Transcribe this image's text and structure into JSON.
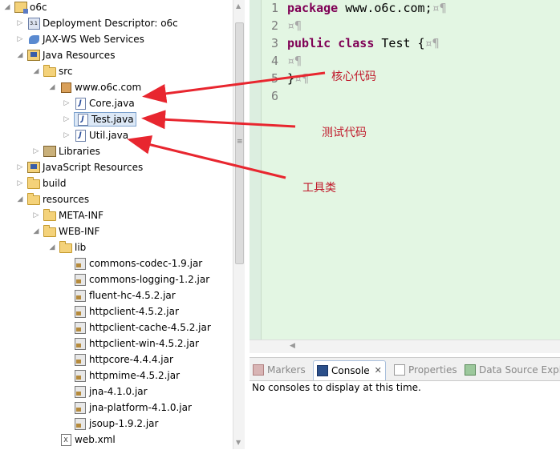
{
  "explorer": {
    "items": [
      {
        "label": "o6c",
        "icon": "project-icon"
      },
      {
        "label": "Deployment Descriptor: o6c",
        "icon": "deployment-descriptor-icon"
      },
      {
        "label": "JAX-WS Web Services",
        "icon": "web-services-icon"
      },
      {
        "label": "Java Resources",
        "icon": "java-resources-icon"
      },
      {
        "label": "src",
        "icon": "source-folder-icon"
      },
      {
        "label": "www.o6c.com",
        "icon": "package-icon"
      },
      {
        "label": "Core.java",
        "icon": "java-file-icon"
      },
      {
        "label": "Test.java",
        "icon": "java-file-icon"
      },
      {
        "label": "Util.java",
        "icon": "java-file-icon"
      },
      {
        "label": "Libraries",
        "icon": "libraries-icon"
      },
      {
        "label": "JavaScript Resources",
        "icon": "javascript-resources-icon"
      },
      {
        "label": "build",
        "icon": "folder-icon"
      },
      {
        "label": "resources",
        "icon": "folder-icon"
      },
      {
        "label": "META-INF",
        "icon": "folder-icon"
      },
      {
        "label": "WEB-INF",
        "icon": "folder-icon"
      },
      {
        "label": "lib",
        "icon": "folder-icon"
      },
      {
        "label": "commons-codec-1.9.jar",
        "icon": "jar-icon"
      },
      {
        "label": "commons-logging-1.2.jar",
        "icon": "jar-icon"
      },
      {
        "label": "fluent-hc-4.5.2.jar",
        "icon": "jar-icon"
      },
      {
        "label": "httpclient-4.5.2.jar",
        "icon": "jar-icon"
      },
      {
        "label": "httpclient-cache-4.5.2.jar",
        "icon": "jar-icon"
      },
      {
        "label": "httpclient-win-4.5.2.jar",
        "icon": "jar-icon"
      },
      {
        "label": "httpcore-4.4.4.jar",
        "icon": "jar-icon"
      },
      {
        "label": "httpmime-4.5.2.jar",
        "icon": "jar-icon"
      },
      {
        "label": "jna-4.1.0.jar",
        "icon": "jar-icon"
      },
      {
        "label": "jna-platform-4.1.0.jar",
        "icon": "jar-icon"
      },
      {
        "label": "jsoup-1.9.2.jar",
        "icon": "jar-icon"
      },
      {
        "label": "web.xml",
        "icon": "xml-file-icon"
      }
    ]
  },
  "editor": {
    "lines": [
      {
        "num": "1",
        "kw": "package",
        "rest": " www.o6c.com;",
        "mark": "¤¶"
      },
      {
        "num": "2",
        "kw": "",
        "rest": "",
        "mark": "¤¶"
      },
      {
        "num": "3",
        "kw": "public class",
        "rest": " Test {",
        "mark": "¤¶"
      },
      {
        "num": "4",
        "kw": "",
        "rest": "",
        "mark": "¤¶"
      },
      {
        "num": "5",
        "kw": "",
        "rest": "}",
        "mark": "¤¶"
      },
      {
        "num": "6",
        "kw": "",
        "rest": "",
        "mark": ""
      }
    ]
  },
  "console": {
    "tabs": [
      {
        "label": "Markers"
      },
      {
        "label": "Console"
      },
      {
        "label": "Properties"
      },
      {
        "label": "Data Source Expl"
      }
    ],
    "close_glyph": "✕",
    "message": "No consoles to display at this time."
  },
  "annotations": {
    "core": "核心代码",
    "test": "测试代码",
    "util": "工具类"
  },
  "colors": {
    "arrow": "#e8262f",
    "editor_bg": "#e3f6e3",
    "keyword": "#7f0055"
  }
}
